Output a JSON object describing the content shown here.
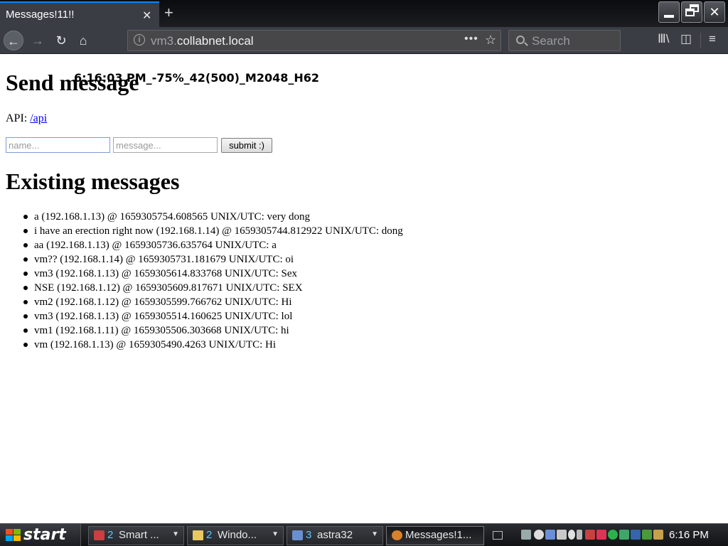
{
  "browser": {
    "tab_title": "Messages!11!!",
    "tab_close": "✕",
    "new_tab": "+",
    "url_prefix": "vm3.",
    "url_domain": "collabnet.local",
    "url_menu": "•••",
    "search_placeholder": "Search",
    "nav": {
      "back": "←",
      "forward": "→",
      "reload": "↻",
      "home": "⌂"
    },
    "icons": [
      "library-icon",
      "sidebar-icon",
      "hamburger-menu-icon"
    ]
  },
  "page": {
    "heading_send": "Send message",
    "overlay_stats": "6:16:03 PM_-75%_42(500)_M2048_H62",
    "api_label": "API: ",
    "api_link": "/api",
    "name_placeholder": "name...",
    "message_placeholder": "message...",
    "submit_label": "submit :)",
    "heading_existing": "Existing messages",
    "messages": [
      "a (192.168.1.13) @ 1659305754.608565 UNIX/UTC: very dong",
      "i have an erection right now (192.168.1.14) @ 1659305744.812922 UNIX/UTC: dong",
      "aa (192.168.1.13) @ 1659305736.635764 UNIX/UTC: a",
      "vm?? (192.168.1.14) @ 1659305731.181679 UNIX/UTC: oi",
      "vm3 (192.168.1.13) @ 1659305614.833768 UNIX/UTC: Sex",
      "NSE (192.168.1.12) @ 1659305609.817671 UNIX/UTC: SEX",
      "vm2 (192.168.1.12) @ 1659305599.766762 UNIX/UTC: Hi",
      "vm3 (192.168.1.13) @ 1659305514.160625 UNIX/UTC: lol",
      "vm1 (192.168.1.11) @ 1659305506.303668 UNIX/UTC: hi",
      "vm (192.168.1.13) @ 1659305490.4263 UNIX/UTC: Hi"
    ]
  },
  "taskbar": {
    "start_label": "start",
    "groups": [
      {
        "count": "2",
        "label": "Smart ...",
        "icon": "shield-icon"
      },
      {
        "count": "2",
        "label": "Windo...",
        "icon": "folder-icon"
      },
      {
        "count": "3",
        "label": "astra32",
        "icon": "computer-icon"
      }
    ],
    "active_window": "Messages!1...",
    "clock": "6:16 PM"
  },
  "colors": {
    "link": "#0000ee",
    "tab_accent": "#0a84ff",
    "chrome_bg": "#3a3d44"
  }
}
